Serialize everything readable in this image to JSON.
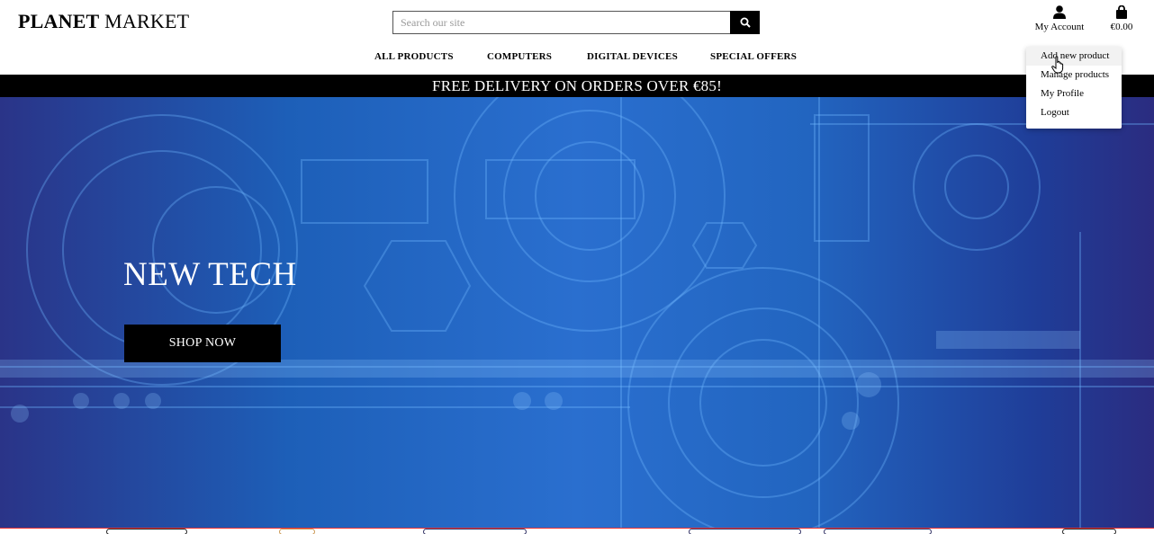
{
  "brand": {
    "name_bold": "PLANET",
    "name_rest": " MARKET"
  },
  "search": {
    "placeholder": "Search our site",
    "icon": "search-icon"
  },
  "account": {
    "label": "My Account",
    "icon": "user-icon"
  },
  "bag": {
    "total": "€0.00",
    "icon": "shopping-bag-icon"
  },
  "nav": [
    "ALL PRODUCTS",
    "COMPUTERS",
    "DIGITAL DEVICES",
    "SPECIAL OFFERS"
  ],
  "promo": "FREE DELIVERY ON ORDERS OVER €85!",
  "hero": {
    "title": "NEW TECH",
    "button": "SHOP NOW"
  },
  "account_menu": [
    "Add new product",
    "Manage products",
    "My Profile",
    "Logout"
  ],
  "colors": {
    "accent": "#000000",
    "hero_start": "#2a3488",
    "hero_mid": "#2a6fcf"
  }
}
